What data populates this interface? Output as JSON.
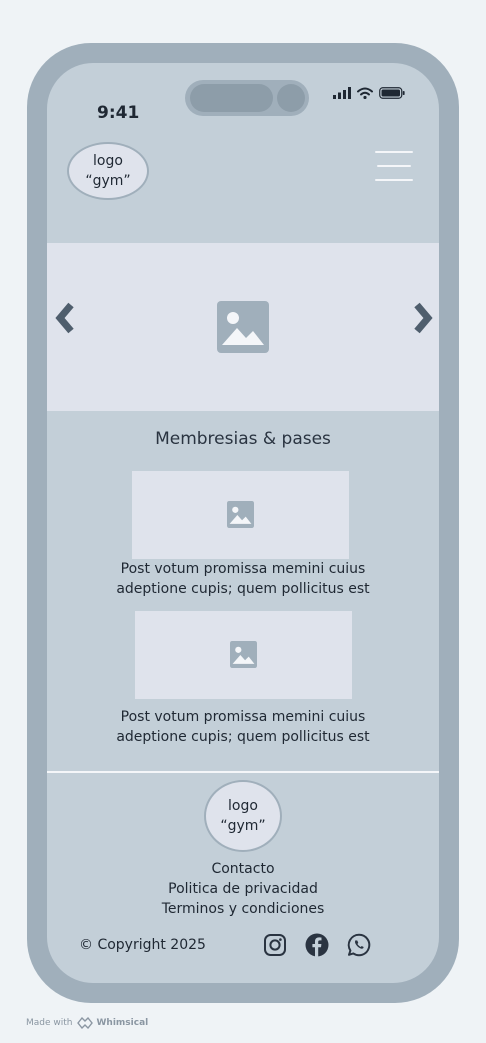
{
  "status_bar": {
    "time": "9:41"
  },
  "header": {
    "logo_text": "logo\n“gym”"
  },
  "hero": {
    "icons": [
      "chevron-left-icon",
      "image-icon",
      "chevron-right-icon"
    ]
  },
  "memberships": {
    "title": "Membresias & pases",
    "cards": [
      {
        "text_line1": "Post votum promissa memini cuius",
        "text_line2": "adeptione cupis; quem pollicitus est"
      },
      {
        "text_line1": "Post votum promissa memini cuius",
        "text_line2": "adeptione cupis; quem pollicitus est"
      }
    ]
  },
  "footer": {
    "logo_text": "logo\n“gym”",
    "links": [
      "Contacto",
      "Politica de privacidad",
      "Terminos y condiciones"
    ],
    "copyright": "© Copyright 2025",
    "socials": [
      "instagram-icon",
      "facebook-icon",
      "whatsapp-icon"
    ]
  },
  "credit": {
    "prefix": "Made with",
    "brand": "Whimsical"
  },
  "colors": {
    "frame": "#a0afbb",
    "screen": "#c3cfd8",
    "placeholder": "#dfe3ec",
    "icon": "#a0afbb",
    "arrow": "#4f5e6d"
  }
}
